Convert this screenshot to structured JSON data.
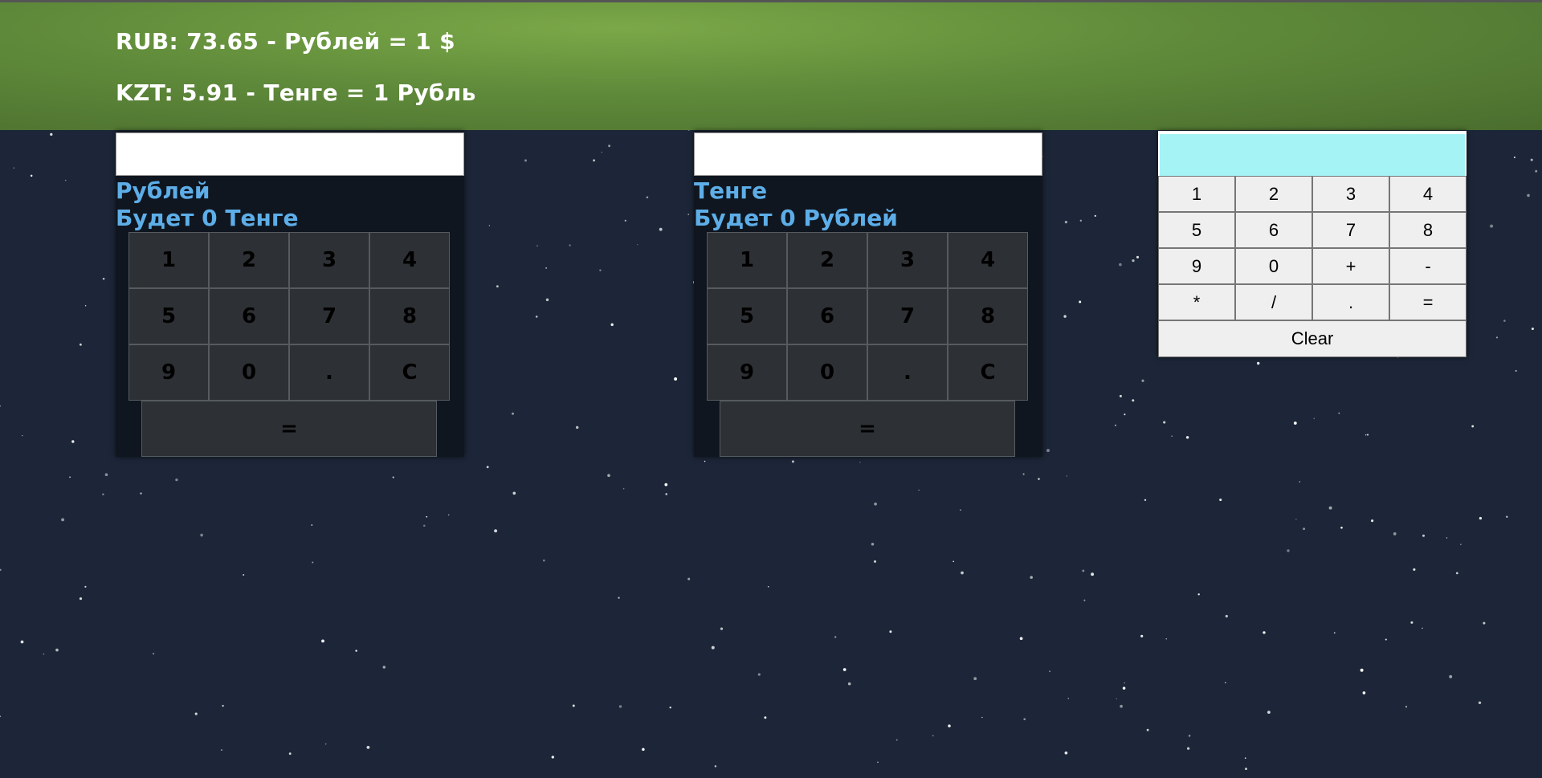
{
  "header": {
    "rate_rub": "RUB: 73.65 - Рублей = 1 $",
    "rate_kzt": "KZT: 5.91 - Тенге = 1 Рубль"
  },
  "converters": [
    {
      "input_value": "",
      "unit_label": "Рублей",
      "result_label": "Будет 0 Тенге",
      "keys": [
        "1",
        "2",
        "3",
        "4",
        "5",
        "6",
        "7",
        "8",
        "9",
        "0",
        ".",
        "C"
      ],
      "equals": "="
    },
    {
      "input_value": "",
      "unit_label": "Тенге",
      "result_label": "Будет 0 Рублей",
      "keys": [
        "1",
        "2",
        "3",
        "4",
        "5",
        "6",
        "7",
        "8",
        "9",
        "0",
        ".",
        "C"
      ],
      "equals": "="
    }
  ],
  "calculator": {
    "display_value": "",
    "keys": [
      "1",
      "2",
      "3",
      "4",
      "5",
      "6",
      "7",
      "8",
      "9",
      "0",
      "+",
      "-",
      "*",
      "/",
      ".",
      "="
    ],
    "clear_label": "Clear"
  },
  "colors": {
    "header_green": "#6a9a40",
    "background": "#1c2638",
    "label_blue": "#5daee8",
    "calc_display": "#a5f3f5",
    "key_dark": "#2d3034"
  }
}
